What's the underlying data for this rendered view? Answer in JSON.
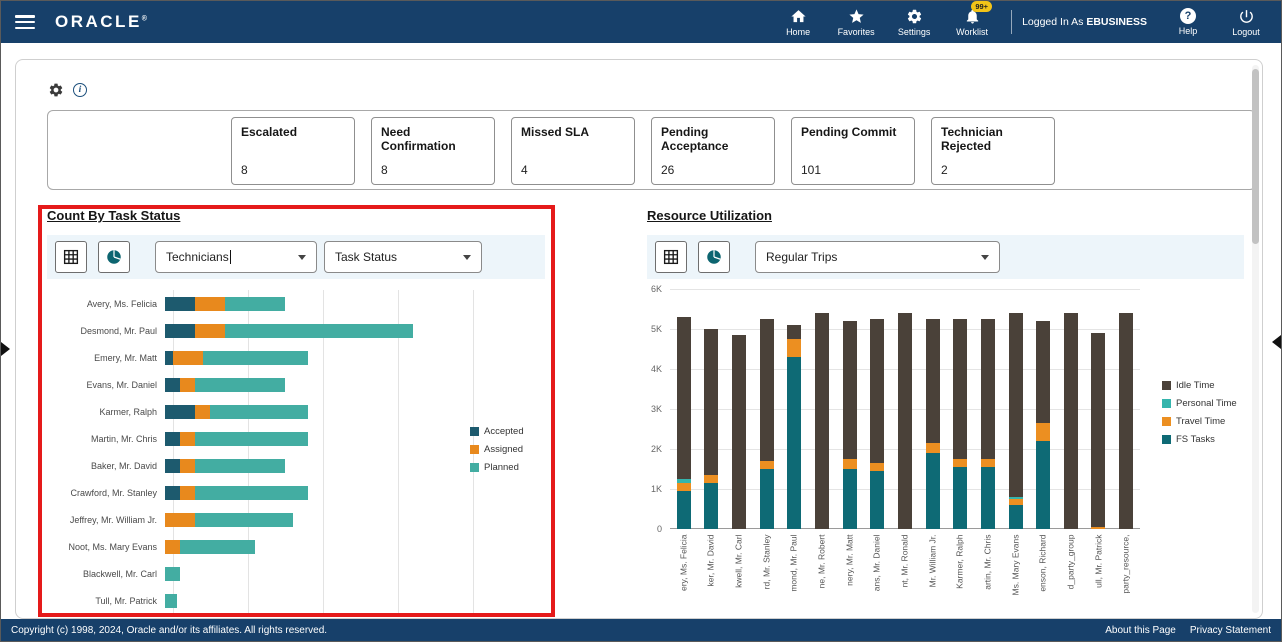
{
  "header": {
    "brand": "ORACLE",
    "nav": [
      {
        "label": "Home"
      },
      {
        "label": "Favorites"
      },
      {
        "label": "Settings"
      },
      {
        "label": "Worklist",
        "badge": "99+"
      }
    ],
    "logged_in_prefix": "Logged In As",
    "logged_in_user": "EBUSINESS",
    "help": "Help",
    "logout": "Logout"
  },
  "kpis": [
    {
      "label": "Escalated",
      "value": "8"
    },
    {
      "label": "Need Confirmation",
      "value": "8"
    },
    {
      "label": "Missed SLA",
      "value": "4"
    },
    {
      "label": "Pending Acceptance",
      "value": "26"
    },
    {
      "label": "Pending Commit",
      "value": "101"
    },
    {
      "label": "Technician Rejected",
      "value": "2"
    }
  ],
  "left_section": {
    "dropdown1": "Technicians",
    "dropdown2": "Task Status"
  },
  "right_section": {
    "dropdown1": "Regular Trips"
  },
  "footer": {
    "copyright": "Copyright (c) 1998, 2024, Oracle and/or its affiliates. All rights reserved.",
    "links": [
      {
        "label": "About this Page"
      },
      {
        "label": "Privacy Statement"
      }
    ]
  },
  "chart_data": [
    {
      "type": "bar",
      "orientation": "horizontal",
      "stacked": true,
      "title": "Count By Task Status",
      "categories": [
        "Avery, Ms. Felicia",
        "Desmond, Mr. Paul",
        "Emery, Mr. Matt",
        "Evans, Mr. Daniel",
        "Karmer, Ralph",
        "Martin, Mr. Chris",
        "Baker, Mr. David",
        "Crawford, Mr. Stanley",
        "Jeffrey, Mr. William Jr.",
        "Noot, Ms. Mary Evans",
        "Blackwell, Mr. Carl",
        "Tull, Mr. Patrick"
      ],
      "series": [
        {
          "name": "Accepted",
          "color": "#1d5a6e",
          "values": [
            2,
            2,
            0.5,
            1,
            2,
            1,
            1,
            1,
            0,
            0,
            0,
            0
          ]
        },
        {
          "name": "Assigned",
          "color": "#e8891d",
          "values": [
            2,
            2,
            2,
            1,
            1,
            1,
            1,
            1,
            2,
            1,
            0,
            0
          ]
        },
        {
          "name": "Planned",
          "color": "#43ada2",
          "values": [
            4,
            12.5,
            7,
            6,
            6.5,
            7.5,
            6,
            7.5,
            6.5,
            5,
            1,
            0.8
          ]
        }
      ],
      "xlim": [
        0,
        20
      ],
      "grid": "vertical",
      "legend_position": "right"
    },
    {
      "type": "bar",
      "orientation": "vertical",
      "stacked": true,
      "title": "Resource Utilization",
      "categories": [
        "ery, Ms. Felicia",
        "ker, Mr. David",
        "kwell, Mr. Carl",
        "rd, Mr. Stanley",
        "mond, Mr. Paul",
        "ne, Mr. Robert",
        "nery, Mr. Matt",
        "ans, Mr. Daniel",
        "nt, Mr. Ronald",
        "Mr. William Jr.",
        "Karmer, Ralph",
        "artin, Mr. Chris",
        "Ms. Mary Evans",
        "enson, Richard",
        "d_party_group",
        "ull, Mr. Patrick",
        "party_resource,"
      ],
      "series": [
        {
          "name": "FS Tasks",
          "color": "#0e6a75",
          "values": [
            0.95,
            1.15,
            0,
            1.5,
            4.3,
            0,
            1.5,
            1.45,
            0,
            1.9,
            1.55,
            1.55,
            0.6,
            2.2,
            0,
            0,
            0
          ]
        },
        {
          "name": "Travel Time",
          "color": "#ec8f21",
          "values": [
            0.2,
            0.2,
            0,
            0.2,
            0.45,
            0,
            0.25,
            0.2,
            0,
            0.25,
            0.2,
            0.2,
            0.15,
            0.45,
            0,
            0.05,
            0
          ]
        },
        {
          "name": "Personal Time",
          "color": "#35b5ad",
          "values": [
            0.1,
            0,
            0,
            0,
            0,
            0,
            0,
            0,
            0,
            0,
            0,
            0,
            0.05,
            0,
            0,
            0,
            0
          ]
        },
        {
          "name": "Idle Time",
          "color": "#4a4139",
          "values": [
            4.05,
            3.65,
            4.85,
            3.55,
            0.35,
            5.4,
            3.45,
            3.6,
            5.4,
            3.1,
            3.5,
            3.5,
            4.6,
            2.55,
            5.4,
            4.85,
            5.4
          ]
        }
      ],
      "legend_order": [
        "Idle Time",
        "Personal Time",
        "Travel Time",
        "FS Tasks"
      ],
      "ylim": [
        0,
        6
      ],
      "yticks": [
        "0",
        "1K",
        "2K",
        "3K",
        "4K",
        "5K",
        "6K"
      ],
      "unit": "K",
      "grid": "horizontal",
      "legend_position": "right"
    }
  ]
}
